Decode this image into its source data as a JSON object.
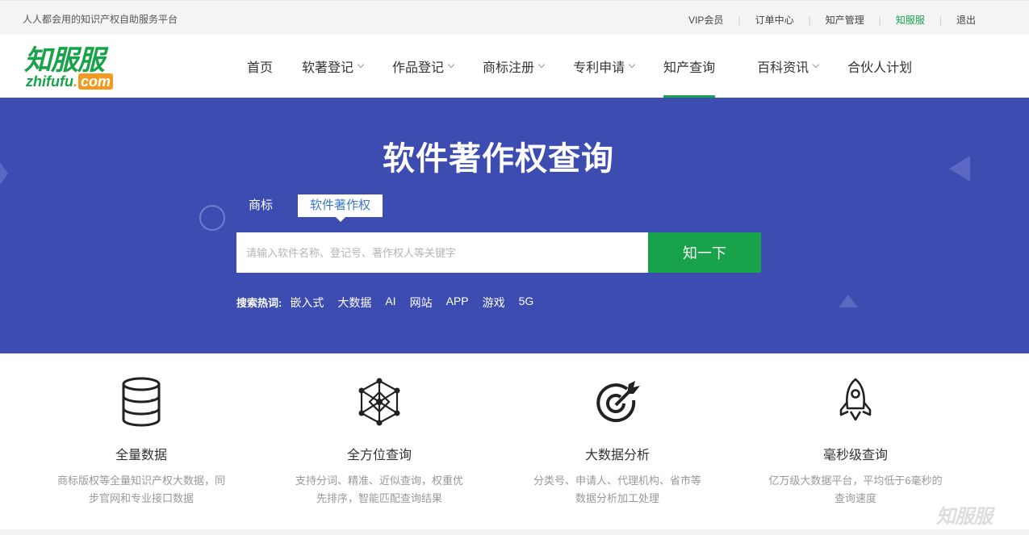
{
  "topbar": {
    "slogan": "人人都会用的知识产权自助服务平台",
    "links": [
      {
        "label": "VIP会员"
      },
      {
        "label": "订单中心"
      },
      {
        "label": "知产管理"
      },
      {
        "label": "知服服"
      },
      {
        "label": "退出"
      }
    ]
  },
  "logo": {
    "cn": "知服服",
    "en_main": "zhifufu",
    "en_dot": ".",
    "en_com": "com"
  },
  "nav": [
    {
      "label": "首页"
    },
    {
      "label": "软著登记"
    },
    {
      "label": "作品登记"
    },
    {
      "label": "商标注册"
    },
    {
      "label": "专利申请"
    },
    {
      "label": "知产查询"
    },
    {
      "label": "百科资讯"
    },
    {
      "label": "合伙人计划"
    }
  ],
  "banner": {
    "title": "软件著作权查询",
    "tabs": [
      {
        "label": "商标"
      },
      {
        "label": "软件著作权"
      }
    ],
    "search_placeholder": "请输入软件名称、登记号、著作权人等关键字",
    "search_button": "知一下",
    "hot_label": "搜索热词:",
    "hot_words": [
      "嵌入式",
      "大数据",
      "AI",
      "网站",
      "APP",
      "游戏",
      "5G"
    ]
  },
  "features": [
    {
      "icon": "database-icon",
      "title": "全量数据",
      "desc": "商标版权等全量知识产权大数据，同步官网和专业接口数据"
    },
    {
      "icon": "network-cube-icon",
      "title": "全方位查询",
      "desc": "支持分词、精准、近似查询，权重优先排序，智能匹配查询结果"
    },
    {
      "icon": "target-icon",
      "title": "大数据分析",
      "desc": "分类号、申请人、代理机构、省市等数据分析加工处理"
    },
    {
      "icon": "rocket-icon",
      "title": "毫秒级查询",
      "desc": "亿万级大数据平台，平均低于6毫秒的查询速度"
    }
  ],
  "watermark": "知服服",
  "colors": {
    "brand_green": "#18a24a",
    "banner_blue": "#3c4cb0",
    "accent_orange": "#f39a1e",
    "tab_active_text": "#3a77c8"
  }
}
